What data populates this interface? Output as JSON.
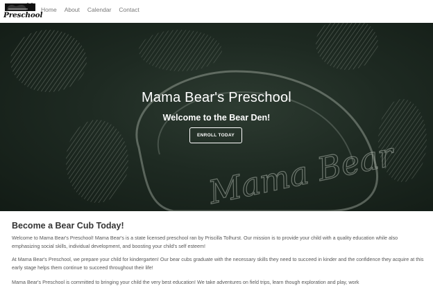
{
  "nav": {
    "logo_icon": "bear-logo-icon",
    "logo_text": "Preschool",
    "links": [
      "Home",
      "About",
      "Calendar",
      "Contact"
    ]
  },
  "hero": {
    "title": "Mama Bear's Preschool",
    "subtitle": "Welcome to the Bear Den!",
    "button_label": "ENROLL TODAY",
    "chalk_text": "Mama Bear"
  },
  "main": {
    "heading": "Become a Bear Cub Today!",
    "paragraphs": [
      "Welcome to Mama Bear's Preschool! Mama Bear's is a state licensed preschool ran by Priscilla Tolhurst. Our mission is to provide your child with a quality education while also emphasizing social skills, individual development, and boosting your child's self esteem!",
      "At Mama Bear's Preschool, we prepare your child for kindergarten! Our bear cubs graduate with the necessary skills they need to succeed in kinder and the confidence they acquire at this early stage helps them continue to succeed throughout their life!",
      "Mama Bear's Preschool is committed to bringing your child the very best education! We take adventures on field trips, learn though exploration and play, work"
    ]
  },
  "colors": {
    "hero_bg": "#1e2a22",
    "chalk": "#c9d0c8",
    "text": "#555555"
  }
}
